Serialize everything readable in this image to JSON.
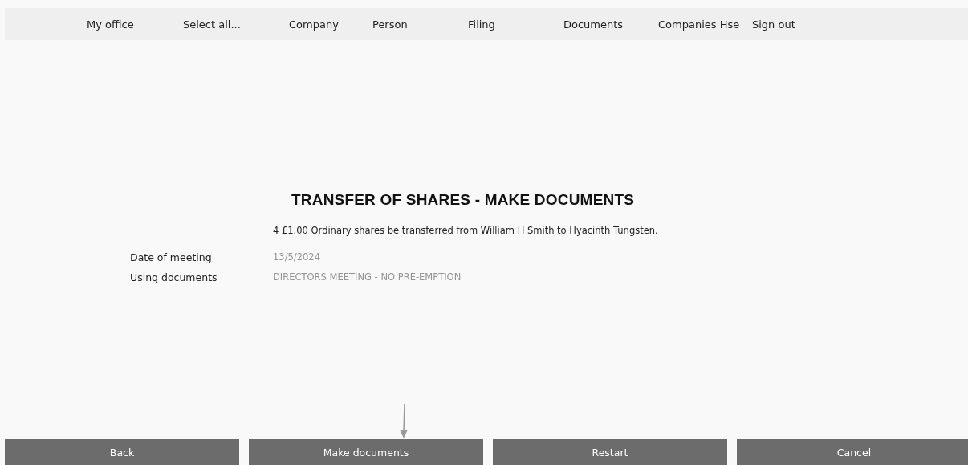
{
  "nav": {
    "items": [
      "My office",
      "Select all...",
      "Company",
      "Person",
      "Filing",
      "Documents",
      "Companies Hse",
      "Sign out"
    ]
  },
  "title": "TRANSFER OF SHARES - MAKE DOCUMENTS",
  "summary": "4 £1.00 Ordinary shares be transferred from William H Smith to Hyacinth Tungsten.",
  "fields": [
    {
      "label": "Date of meeting",
      "value": "13/5/2024"
    },
    {
      "label": "Using documents",
      "value": "DIRECTORS MEETING - NO PRE-EMPTION"
    }
  ],
  "buttons": [
    "Back",
    "Make documents",
    "Restart",
    "Cancel"
  ]
}
